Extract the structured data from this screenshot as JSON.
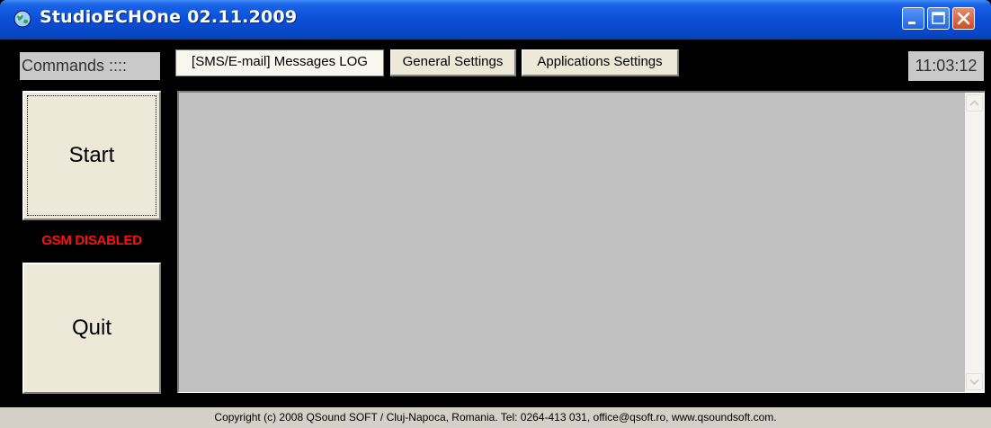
{
  "window": {
    "title": "StudioECHOne 02.11.2009",
    "app_icon": "globe-icon",
    "controls": {
      "minimize": "minimize-icon",
      "maximize": "maximize-icon",
      "close": "close-icon"
    }
  },
  "toolbar": {
    "commands_label": "Commands ::::",
    "tabs": [
      {
        "label": "[SMS/E-mail] Messages LOG",
        "active": true
      },
      {
        "label": "General Settings",
        "active": false
      },
      {
        "label": "Applications Settings",
        "active": false
      }
    ],
    "clock": "11:03:12"
  },
  "sidebar": {
    "start_label": "Start",
    "gsm_status": "GSM DISABLED",
    "quit_label": "Quit"
  },
  "footer": {
    "copyright": "Copyright (c) 2008  QSound SOFT / Cluj-Napoca, Romania. Tel: 0264-413 031, office@qsoft.ro, www.qsoundsoft.com."
  },
  "colors": {
    "background": "#000000",
    "titlebar": "#0a4fd6",
    "gsm_status": "#ff1010",
    "log_area": "#c0c0c0",
    "button_face": "#ece9d8"
  }
}
